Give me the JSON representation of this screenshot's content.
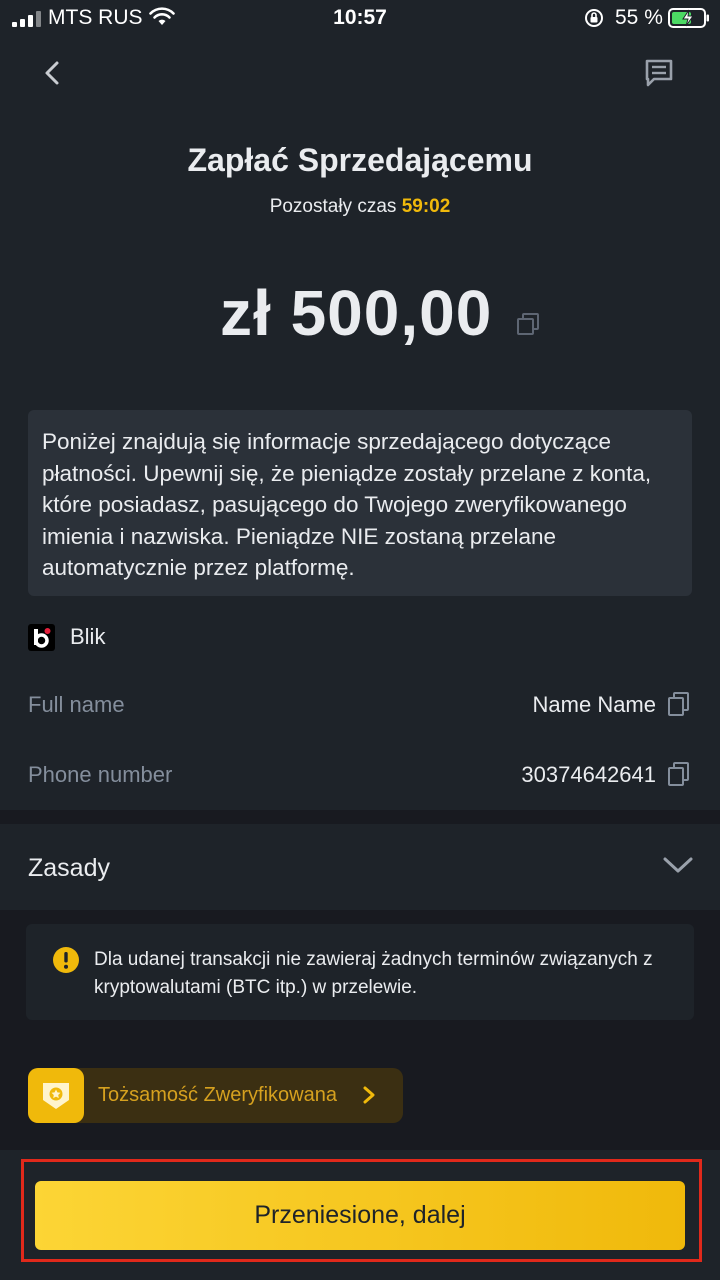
{
  "status_bar": {
    "carrier": "MTS RUS",
    "time": "10:57",
    "battery": "55 %"
  },
  "header": {
    "title": "Zapłać Sprzedającemu",
    "timer_label": "Pozostały czas",
    "timer_value": "59:02"
  },
  "amount": "zł 500,00",
  "info_text": "Poniżej znajdują się informacje sprzedającego dotyczące płatności. Upewnij się, że pieniądze zostały przelane z konta, które posiadasz, pasującego do Twojego zweryfikowanego imienia i nazwiska. Pieniądze NIE zostaną przelane automatycznie przez platformę.",
  "payment_method": "Blik",
  "fields": [
    {
      "label": "Full name",
      "value": "Name Name"
    },
    {
      "label": "Phone number",
      "value": "30374642641"
    }
  ],
  "rules": {
    "label": "Zasady",
    "warning": "Dla udanej transakcji nie zawieraj żadnych terminów związanych z kryptowalutami (BTC itp.) w przelewie."
  },
  "verified": "Tożsamość Zweryfikowana",
  "primary_button": "Przeniesione, dalej",
  "colors": {
    "background": "#1e2329",
    "accent": "#f0b90b",
    "highlight_frame": "#e0291b"
  }
}
